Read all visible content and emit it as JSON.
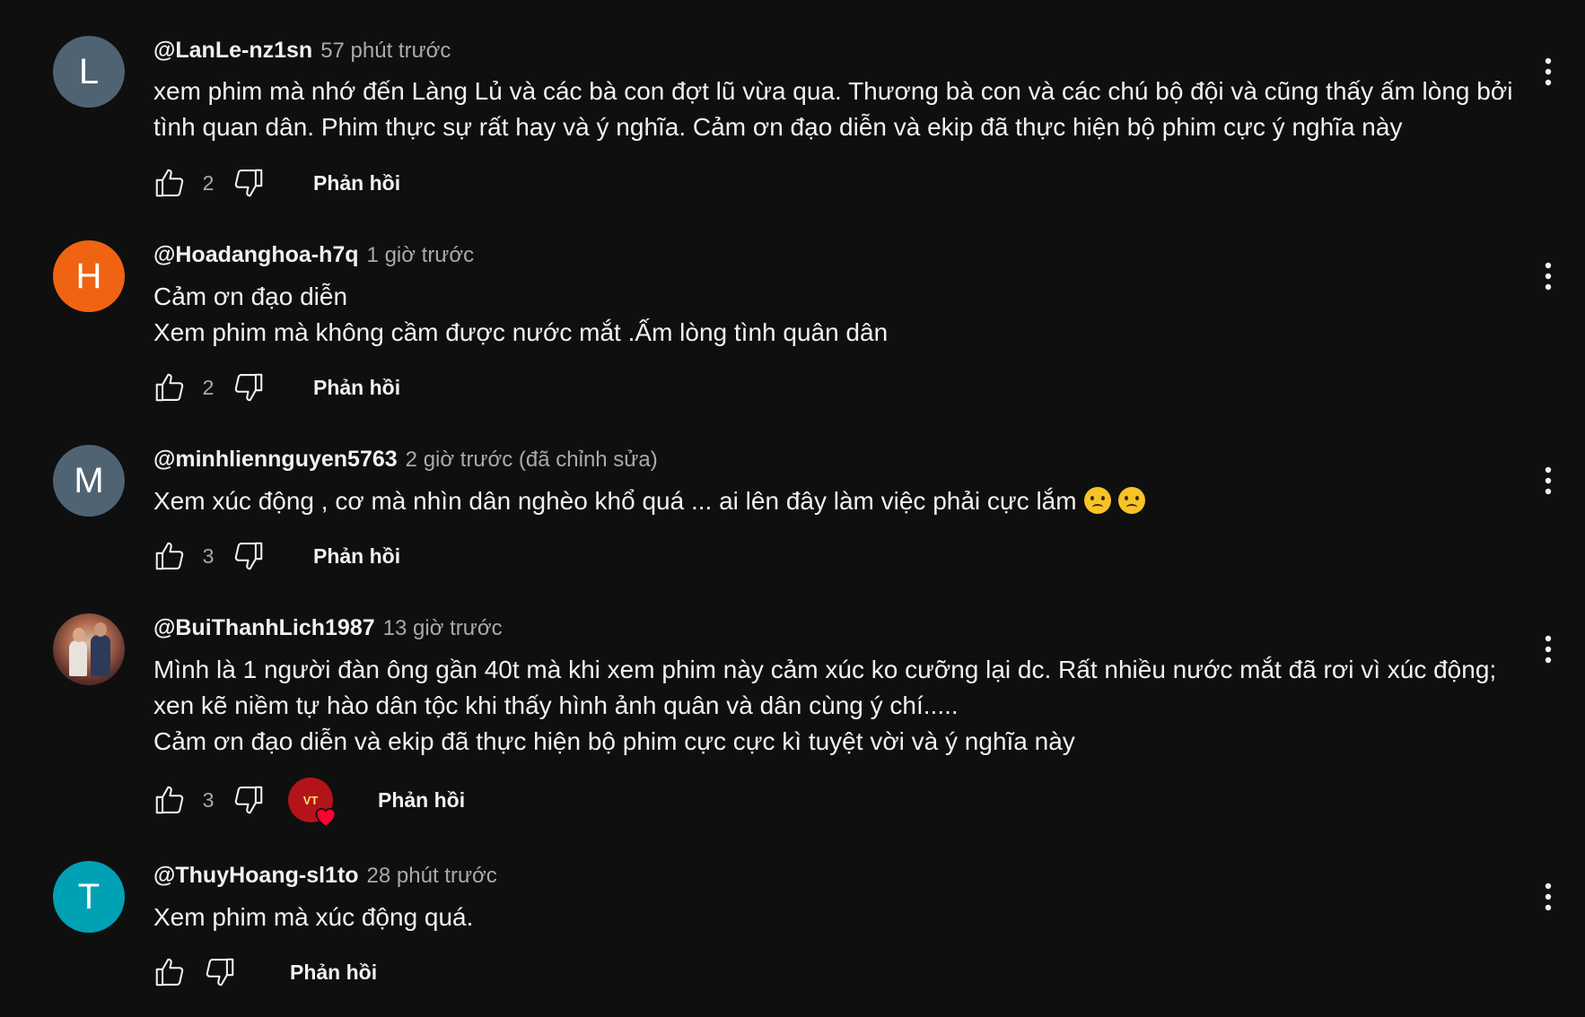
{
  "comments": [
    {
      "avatar_letter": "L",
      "avatar_color": "#4f6373",
      "author": "@LanLe-nz1sn",
      "time": "57 phút trước",
      "lines": [
        "xem phim mà nhớ đến Làng Lủ và các bà con đợt lũ vừa qua. Thương bà con và các chú bộ đội và cũng thấy ấm lòng bởi",
        "tình quan dân. Phim thực sự rất hay và ý nghĩa. Cảm ơn đạo diễn và ekip đã thực hiện bộ phim cực ý nghĩa này"
      ],
      "likes": "2",
      "reply_label": "Phản hồi"
    },
    {
      "avatar_letter": "H",
      "avatar_color": "#f06312",
      "author": "@Hoadanghoa-h7q",
      "time": "1 giờ trước",
      "lines": [
        "Cảm ơn đạo diễn",
        "Xem phim mà không cầm được nước mắt .Ấm lòng tình quân dân"
      ],
      "likes": "2",
      "reply_label": "Phản hồi"
    },
    {
      "avatar_letter": "M",
      "avatar_color": "#4f6373",
      "author": "@minhliennguyen5763",
      "time": "2 giờ trước (đã chỉnh sửa)",
      "lines": [
        "Xem xúc động , cơ mà nhìn dân nghèo khổ quá ... ai lên đây làm việc phải cực lắm"
      ],
      "emoji": "crying-face",
      "likes": "3",
      "reply_label": "Phản hồi"
    },
    {
      "avatar_photo": true,
      "author": "@BuiThanhLich1987",
      "time": "13 giờ trước",
      "lines": [
        "Mình là 1 người đàn ông gần 40t mà khi xem phim này cảm xúc ko cưỡng lại dc. Rất nhiều nước mắt đã rơi vì xúc động;",
        "xen kẽ niềm tự hào dân tộc khi thấy hình ảnh quân và dân cùng ý chí.....",
        "Cảm ơn đạo diễn và ekip đã thực hiện bộ phim cực cực kì tuyệt vời và ý nghĩa này"
      ],
      "likes": "3",
      "creator_heart": true,
      "reply_label": "Phản hồi"
    },
    {
      "avatar_letter": "T",
      "avatar_color": "#00a1b5",
      "author": "@ThuyHoang-sl1to",
      "time": "28 phút trước",
      "lines": [
        "Xem phim mà xúc động quá."
      ],
      "likes": "",
      "reply_label": "Phản hồi"
    }
  ],
  "icons": {
    "like": "thumbs-up-icon",
    "dislike": "thumbs-down-icon",
    "menu": "more-vert-icon",
    "heart": "creator-heart-icon"
  },
  "colors": {
    "background": "#0f0f0f",
    "text": "#f1f1f1",
    "secondary_text": "#aaaaaa",
    "heart": "#ff0033"
  }
}
